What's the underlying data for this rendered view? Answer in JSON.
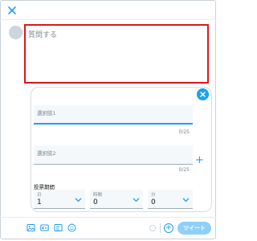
{
  "compose": {
    "placeholder": "質問する"
  },
  "poll": {
    "choices": [
      {
        "placeholder": "選択肢1",
        "counter": "0/25"
      },
      {
        "placeholder": "選択肢2",
        "counter": "0/25"
      }
    ],
    "add_choice_label": "+",
    "length_label": "投票期間",
    "length_fields": [
      {
        "label": "日",
        "value": "1"
      },
      {
        "label": "時間",
        "value": "0"
      },
      {
        "label": "分",
        "value": "0"
      }
    ]
  },
  "toolbar": {
    "icons": [
      "image-icon",
      "gif-icon",
      "poll-icon",
      "emoji-icon"
    ],
    "add_tweet_label": "+",
    "tweet_label": "ツイート"
  },
  "colors": {
    "accent": "#1da1f2",
    "highlight_border": "#e0151b",
    "tweet_button_disabled": "#8ed0f9"
  }
}
